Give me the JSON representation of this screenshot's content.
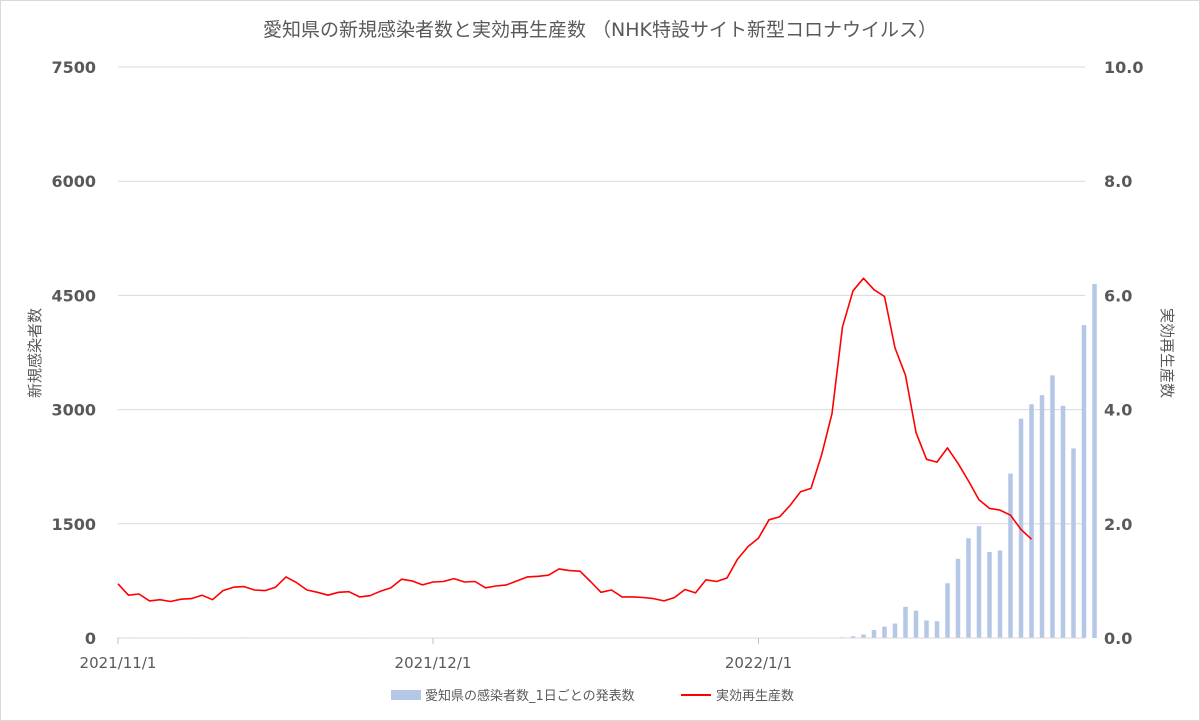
{
  "chart_data": {
    "type": "bar+line",
    "title": "愛知県の新規感染者数と実効再生産数 （NHK特設サイト新型コロナウイルス）",
    "ylabel_left": "新規感染者数",
    "ylabel_right": "実効再生産数",
    "ylim_left": [
      0,
      7500
    ],
    "ylim_right": [
      0.0,
      10.0
    ],
    "yticks_left": [
      "0",
      "1500",
      "3000",
      "4500",
      "6000",
      "7500"
    ],
    "yticks_right": [
      "0.0",
      "2.0",
      "4.0",
      "6.0",
      "8.0",
      "10.0"
    ],
    "xtick_labels": [
      "2021/11/1",
      "2021/12/1",
      "2022/1/1"
    ],
    "start_date": "2021-11-01",
    "grid": true,
    "legend_position": "bottom",
    "series": [
      {
        "name": "愛知県の感染者数_1日ごとの発表数",
        "type": "bar",
        "axis": "left",
        "color": "#b4c7e7",
        "values": [
          4,
          8,
          3,
          6,
          2,
          5,
          3,
          7,
          2,
          4,
          3,
          6,
          8,
          3,
          2,
          4,
          5,
          3,
          6,
          2,
          4,
          3,
          5,
          7,
          4,
          2,
          3,
          4,
          6,
          5,
          3,
          2,
          4,
          3,
          5,
          2,
          4,
          3,
          5,
          6,
          4,
          3,
          4,
          3,
          4,
          5,
          3,
          4,
          5,
          6,
          3,
          4,
          5,
          3,
          4,
          6,
          5,
          4,
          3,
          3,
          3,
          5,
          2,
          4,
          2,
          3,
          7,
          5,
          6,
          10,
          22,
          45,
          105,
          150,
          190,
          410,
          360,
          230,
          220,
          720,
          1040,
          1310,
          1470,
          1130,
          1150,
          2160,
          2880,
          3070,
          3190,
          3450,
          3050,
          2490,
          4110,
          4650
        ]
      },
      {
        "name": "実効再生産数",
        "type": "line",
        "axis": "right",
        "color": "#ff0000",
        "values": [
          0.95,
          0.75,
          0.77,
          0.65,
          0.67,
          0.64,
          0.68,
          0.69,
          0.75,
          0.67,
          0.83,
          0.89,
          0.9,
          0.84,
          0.83,
          0.89,
          1.07,
          0.97,
          0.84,
          0.8,
          0.75,
          0.8,
          0.81,
          0.72,
          0.74,
          0.82,
          0.88,
          1.03,
          1.0,
          0.93,
          0.98,
          0.99,
          1.04,
          0.98,
          0.99,
          0.88,
          0.91,
          0.93,
          1.0,
          1.07,
          1.08,
          1.1,
          1.21,
          1.18,
          1.17,
          0.99,
          0.8,
          0.84,
          0.72,
          0.72,
          0.71,
          0.69,
          0.65,
          0.71,
          0.85,
          0.79,
          1.02,
          0.99,
          1.05,
          1.38,
          1.6,
          1.75,
          2.07,
          2.12,
          2.32,
          2.56,
          2.62,
          3.2,
          3.93,
          5.45,
          6.08,
          6.3,
          6.1,
          5.98,
          5.08,
          4.6,
          3.6,
          3.13,
          3.08,
          3.33,
          3.06,
          2.75,
          2.42,
          2.27,
          2.24,
          2.15,
          1.9,
          1.73
        ]
      }
    ]
  }
}
